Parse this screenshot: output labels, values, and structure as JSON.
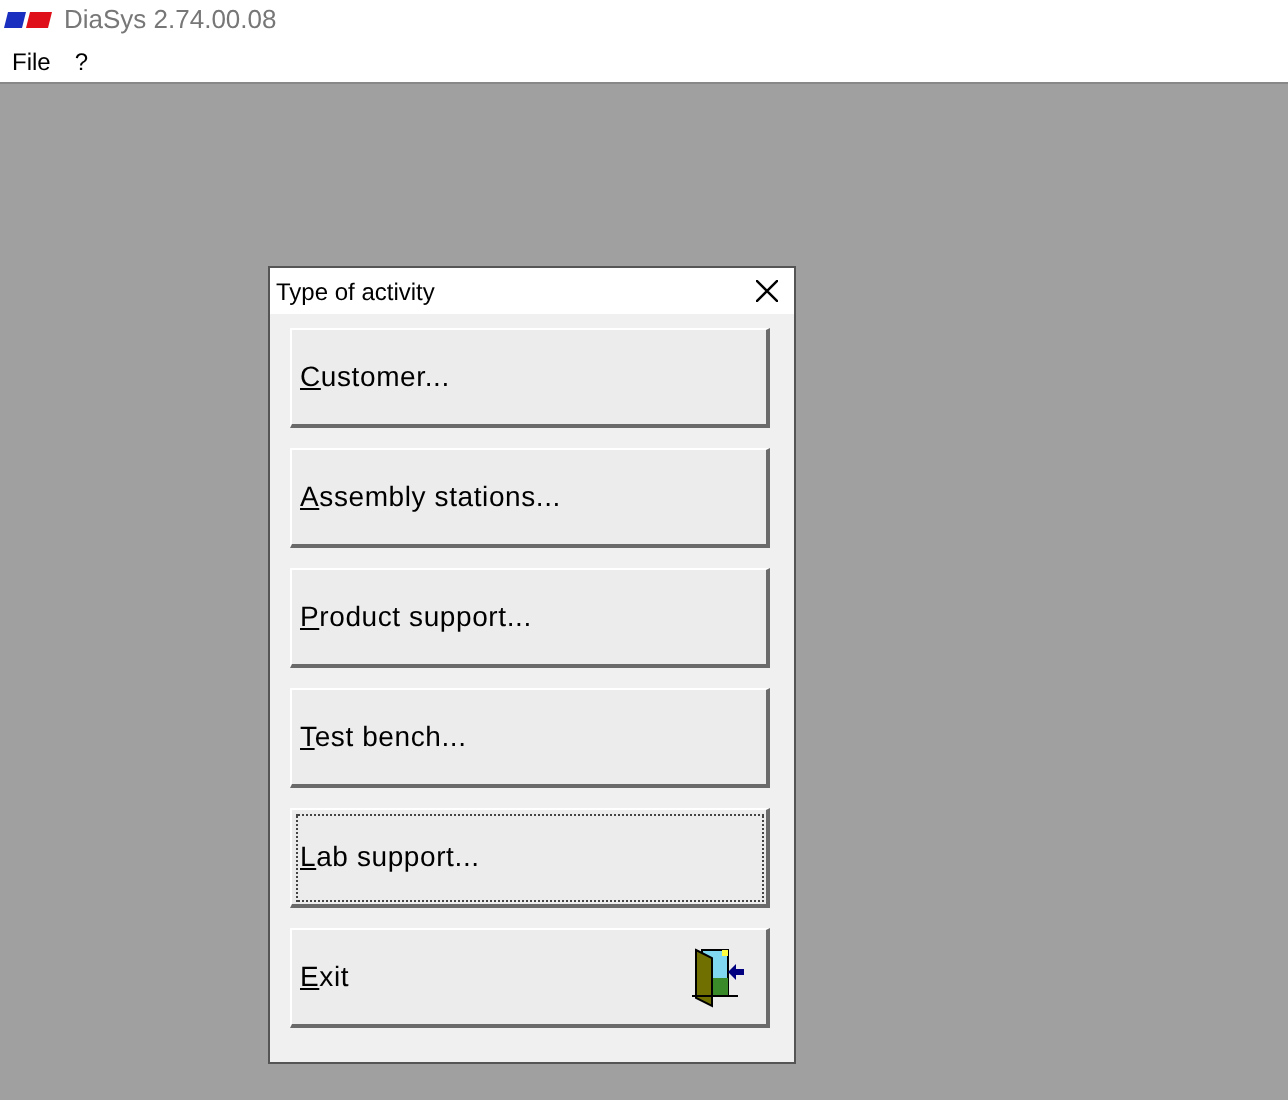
{
  "window": {
    "title": "DiaSys 2.74.00.08"
  },
  "menu": [
    "File",
    "?"
  ],
  "dialog": {
    "title": "Type of activity",
    "buttons": [
      {
        "label": "Customer...",
        "kind": "plain",
        "focused": false
      },
      {
        "label": "Assembly stations...",
        "kind": "plain",
        "focused": false
      },
      {
        "label": "Product support...",
        "kind": "plain",
        "focused": false
      },
      {
        "label": "Test bench...",
        "kind": "plain",
        "focused": false
      },
      {
        "label": "Lab support...",
        "kind": "plain",
        "focused": true
      },
      {
        "label": "Exit",
        "kind": "exit",
        "focused": false
      }
    ]
  }
}
